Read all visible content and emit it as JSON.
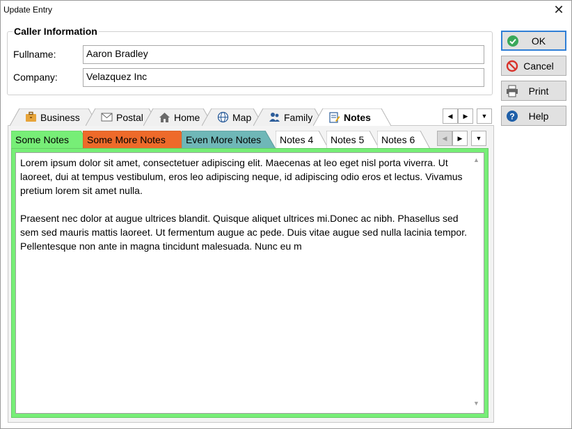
{
  "window": {
    "title": "Update Entry",
    "close_glyph": "✕"
  },
  "caller": {
    "group_title": "Caller Information",
    "fullname_label": "Fullname:",
    "fullname_value": "Aaron Bradley",
    "company_label": "Company:",
    "company_value": "Velazquez Inc"
  },
  "buttons": {
    "ok": "OK",
    "cancel": "Cancel",
    "print": "Print",
    "help": "Help"
  },
  "outer_tabs": [
    {
      "label": "Business",
      "icon": "briefcase-icon"
    },
    {
      "label": "Postal",
      "icon": "envelope-icon"
    },
    {
      "label": "Home",
      "icon": "house-icon"
    },
    {
      "label": "Map",
      "icon": "globe-icon"
    },
    {
      "label": "Family",
      "icon": "people-icon"
    },
    {
      "label": "Notes",
      "icon": "notepad-icon",
      "active": true
    }
  ],
  "inner_tabs": [
    {
      "label": "Some Notes",
      "color": "#77ee77",
      "active": true
    },
    {
      "label": "Some More Notes",
      "color": "#ee6a2a"
    },
    {
      "label": "Even More Notes",
      "color": "#6fb7b7"
    },
    {
      "label": "Notes 4",
      "color": "#ffffff"
    },
    {
      "label": "Notes 5",
      "color": "#ffffff"
    },
    {
      "label": "Notes 6",
      "color": "#ffffff"
    }
  ],
  "tab_scroll": {
    "left": "◀",
    "right": "▶",
    "menu": "▼"
  },
  "notes": {
    "paragraph1": "Lorem ipsum dolor sit amet, consectetuer adipiscing elit. Maecenas at leo eget nisl porta viverra. Ut laoreet, dui at tempus vestibulum, eros leo adipiscing neque, id adipiscing odio eros et lectus. Vivamus pretium lorem sit amet nulla.",
    "paragraph2": "Praesent nec dolor at augue ultrices blandit. Quisque aliquet ultrices mi.Donec ac nibh. Phasellus sed sem sed mauris mattis laoreet. Ut fermentum augue ac pede. Duis vitae augue sed nulla lacinia tempor. Pellentesque non ante in magna tincidunt malesuada. Nunc eu m"
  },
  "scroll_arrows": {
    "up": "▲",
    "down": "▼"
  }
}
